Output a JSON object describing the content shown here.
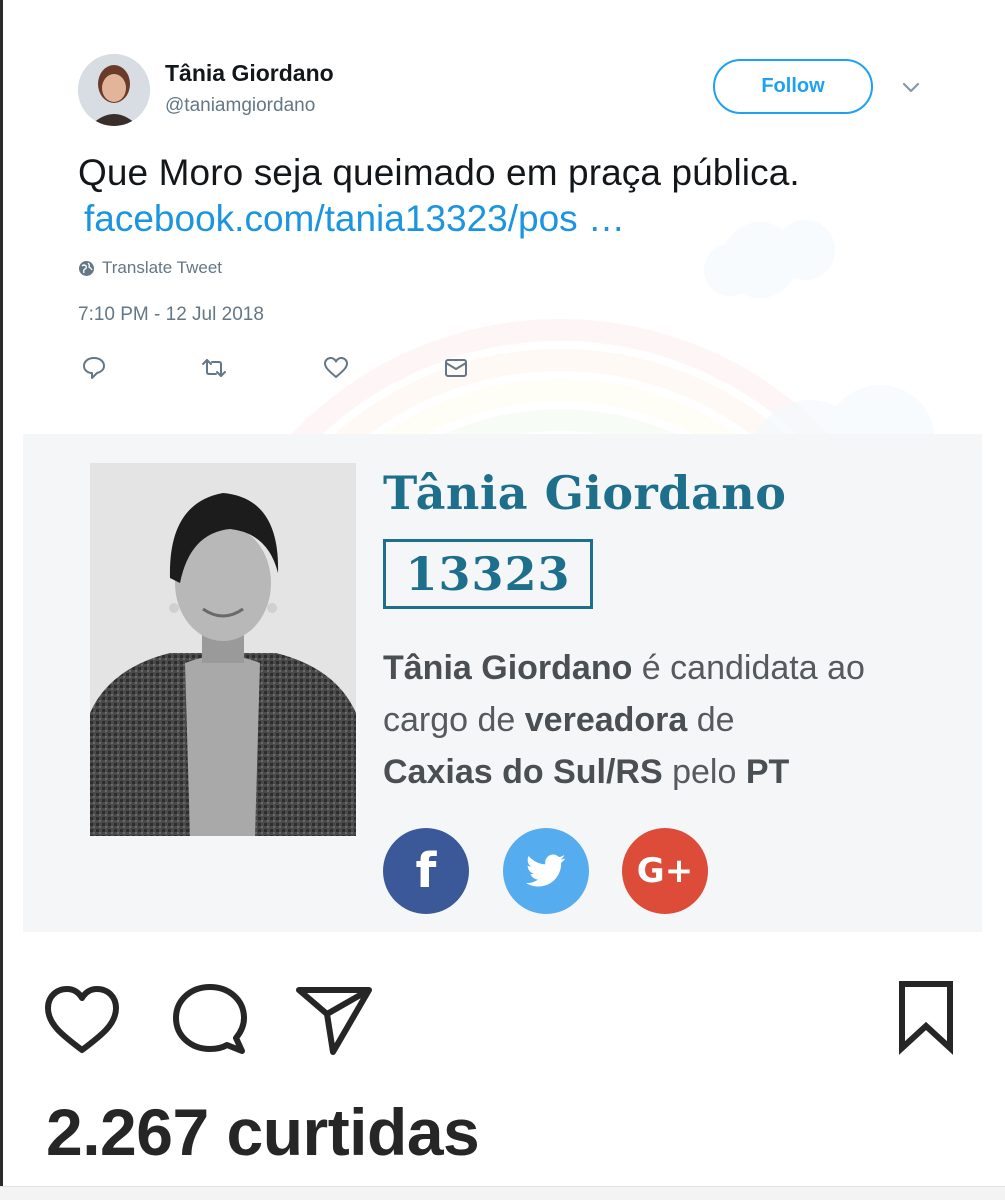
{
  "tweet": {
    "author_name": "Tânia Giordano",
    "author_handle": "@taniamgiordano",
    "follow_label": "Follow",
    "text": "Que Moro seja queimado em praça pública.",
    "link": "facebook.com/tania13323/pos …",
    "translate_label": "Translate Tweet",
    "timestamp": "7:10 PM - 12 Jul 2018",
    "actions": [
      "reply-icon",
      "retweet-icon",
      "like-icon",
      "message-icon"
    ]
  },
  "card": {
    "name": "Tânia Giordano",
    "number": "13323",
    "desc": {
      "part1": "Tânia Giordano",
      "part2": " é candidata ao cargo de ",
      "part3": "vereadora",
      "part4": " de ",
      "part5": "Caxias do Sul/RS",
      "part6": " pelo ",
      "part7": "PT"
    },
    "social": {
      "facebook_glyph": "f",
      "googleplus_glyph": "G+"
    }
  },
  "instagram": {
    "likes": "2.267 curtidas",
    "icons": [
      "heart-icon",
      "comment-icon",
      "send-icon",
      "bookmark-icon"
    ]
  },
  "colors": {
    "twitter_blue": "#1da1f2",
    "link_blue": "#1b95e0",
    "candidate_teal": "#1d6f8c",
    "facebook": "#3b5998",
    "twitter": "#55acee",
    "googleplus": "#dd4b39"
  }
}
